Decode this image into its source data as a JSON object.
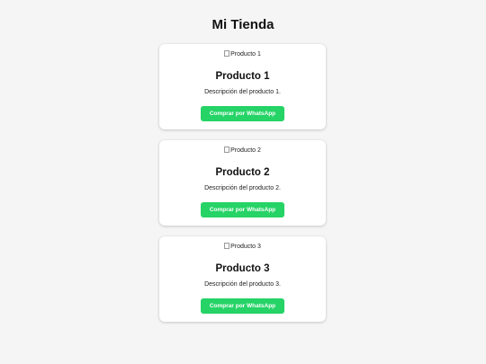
{
  "page": {
    "title": "Mi Tienda"
  },
  "theme": {
    "background": "#f5f5f5",
    "card_background": "#ffffff",
    "button_color": "#25d366",
    "button_text_color": "#ffffff"
  },
  "products": [
    {
      "image_alt": "Producto 1",
      "name": "Producto 1",
      "description": "Descripción del producto 1.",
      "button_label": "Comprar por WhatsApp"
    },
    {
      "image_alt": "Producto 2",
      "name": "Producto 2",
      "description": "Descripción del producto 2.",
      "button_label": "Comprar por WhatsApp"
    },
    {
      "image_alt": "Producto 3",
      "name": "Producto 3",
      "description": "Descripción del producto 3.",
      "button_label": "Comprar por WhatsApp"
    }
  ]
}
